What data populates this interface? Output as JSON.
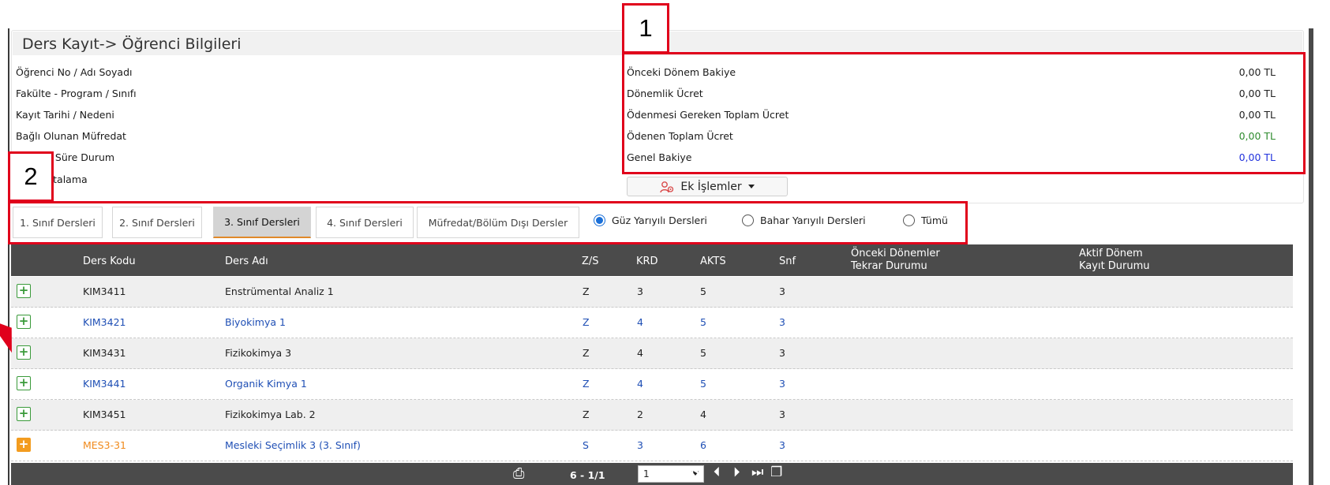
{
  "page_title": "Ders Kayıt-> Öğrenci Bilgileri",
  "student_info": {
    "labels": [
      "Öğrenci No / Adı Soyadı",
      "Fakülte - Program / Sınıfı",
      "Kayıt Tarihi / Nedeni",
      "Bağlı Olunan Müfredat",
      "n Süre Durum",
      "rtalama"
    ]
  },
  "fees": {
    "rows": [
      {
        "label": "Önceki Dönem Bakiye",
        "value": "0,00 TL",
        "color": "#1a1a1a"
      },
      {
        "label": "Dönemlik Ücret",
        "value": "0,00 TL",
        "color": "#1a1a1a"
      },
      {
        "label": "Ödenmesi Gereken Toplam Ücret",
        "value": "0,00 TL",
        "color": "#1a1a1a"
      },
      {
        "label": "Ödenen Toplam Ücret",
        "value": "0,00 TL",
        "color": "#2e8b2e"
      },
      {
        "label": "Genel Bakiye",
        "value": "0,00 TL",
        "color": "#2233dd"
      }
    ]
  },
  "ek_button": {
    "label": "Ek İşlemler",
    "icon": "users-gear-icon"
  },
  "tabs": [
    {
      "label": "1. Sınıf Dersleri",
      "active": false
    },
    {
      "label": "2. Sınıf Dersleri",
      "active": false
    },
    {
      "label": "3. Sınıf Dersleri",
      "active": true
    },
    {
      "label": "4. Sınıf Dersleri",
      "active": false
    },
    {
      "label": "Müfredat/Bölüm Dışı Dersler",
      "active": false
    }
  ],
  "semester_filter": [
    {
      "label": "Güz Yarıyılı Dersleri",
      "checked": true
    },
    {
      "label": "Bahar Yarıyılı Dersleri",
      "checked": false
    },
    {
      "label": "Tümü",
      "checked": false
    }
  ],
  "grid": {
    "columns": {
      "code": "Ders Kodu",
      "name": "Ders Adı",
      "zs": "Z/S",
      "krd": "KRD",
      "akts": "AKTS",
      "snf": "Snf",
      "prev_line1": "Önceki Dönemler",
      "prev_line2": "Tekrar Durumu",
      "active_line1": "Aktif Dönem",
      "active_line2": "Kayıt Durumu"
    },
    "rows": [
      {
        "code": "KIM3411",
        "name": "Enstrümental Analiz 1",
        "zs": "Z",
        "krd": "3",
        "akts": "5",
        "snf": "3",
        "style": "plain"
      },
      {
        "code": "KIM3421",
        "name": "Biyokimya 1",
        "zs": "Z",
        "krd": "4",
        "akts": "5",
        "snf": "3",
        "style": "blue"
      },
      {
        "code": "KIM3431",
        "name": "Fizikokimya 3",
        "zs": "Z",
        "krd": "4",
        "akts": "5",
        "snf": "3",
        "style": "plain"
      },
      {
        "code": "KIM3441",
        "name": "Organik Kimya 1",
        "zs": "Z",
        "krd": "4",
        "akts": "5",
        "snf": "3",
        "style": "blue"
      },
      {
        "code": "KIM3451",
        "name": "Fizikokimya Lab. 2",
        "zs": "Z",
        "krd": "2",
        "akts": "4",
        "snf": "3",
        "style": "plain"
      },
      {
        "code": "MES3-31",
        "name": "Mesleki Seçimlik 3 (3. Sınıf)",
        "zs": "S",
        "krd": "3",
        "akts": "6",
        "snf": "3",
        "style": "elective"
      }
    ]
  },
  "pager": {
    "info": "6 - 1/1",
    "page_select": "1"
  },
  "annotations": {
    "box1": "1",
    "box2": "2"
  },
  "colors": {
    "blue_text": "#1f4fb5",
    "orange_text": "#f08a1c",
    "header_bg": "#4b4b4b",
    "annotation_red": "#e0001b"
  }
}
